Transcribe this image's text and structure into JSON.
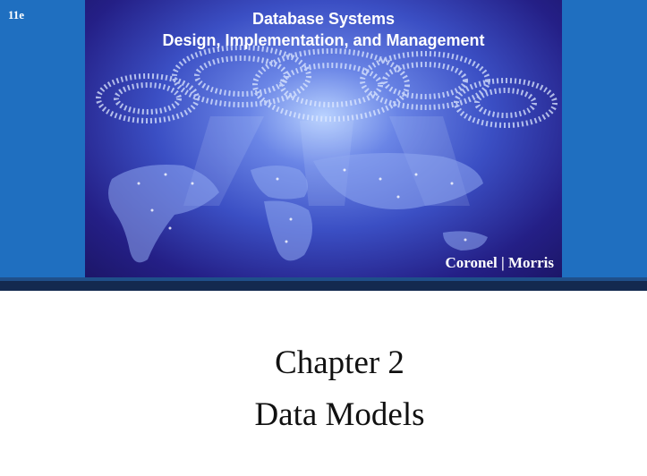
{
  "edition": "11e",
  "cover": {
    "title_line_1": "Database Systems",
    "title_line_2": "Design, Implementation, and Management",
    "authors": "Coronel | Morris"
  },
  "chapter": {
    "number_label": "Chapter 2",
    "title": "Data Models"
  },
  "colors": {
    "side_band": "#1f6fc0",
    "divider_dark": "#13294f",
    "divider_light": "#1f4f8a"
  }
}
